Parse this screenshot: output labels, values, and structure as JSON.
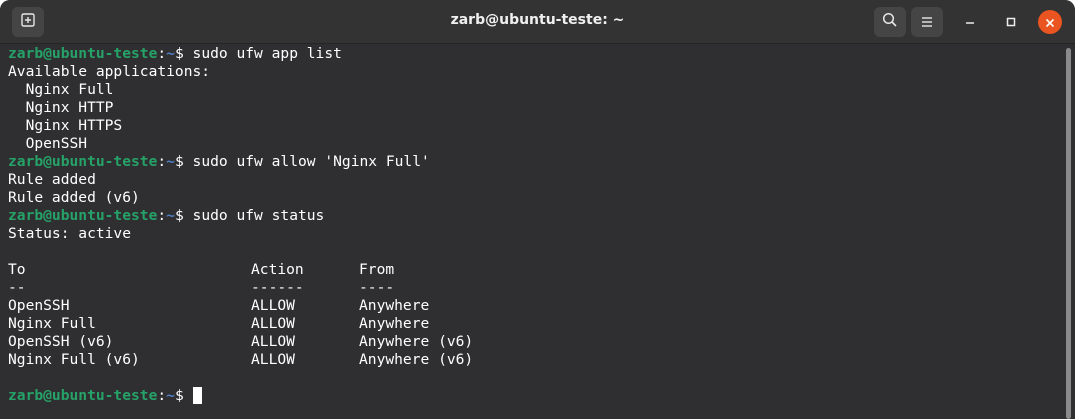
{
  "window": {
    "title": "zarb@ubuntu-teste: ~"
  },
  "titlebar": {
    "new_tab_icon": "new-tab-icon",
    "search_icon": "search-icon",
    "menu_icon": "hamburger-menu-icon",
    "minimize_icon": "minimize-icon",
    "maximize_icon": "maximize-icon",
    "close_icon": "close-icon"
  },
  "colors": {
    "prompt_user": "#26a269",
    "prompt_path": "#4e7ec2",
    "background": "#2f2f31",
    "close_button": "#e95420"
  },
  "prompt": {
    "user_host": "zarb@ubuntu-teste",
    "colon": ":",
    "path": "~",
    "symbol": "$ "
  },
  "terminal": {
    "cmd1": "sudo ufw app list",
    "out_available": "Available applications:",
    "apps": [
      "  Nginx Full",
      "  Nginx HTTP",
      "  Nginx HTTPS",
      "  OpenSSH"
    ],
    "cmd2": "sudo ufw allow 'Nginx Full'",
    "rule_added": "Rule added",
    "rule_added_v6": "Rule added (v6)",
    "cmd3": "sudo ufw status",
    "status": "Status: active",
    "table": {
      "headers": [
        "To",
        "Action",
        "From"
      ],
      "separators": [
        "--",
        "------",
        "----"
      ],
      "rows": [
        [
          "OpenSSH",
          "ALLOW",
          "Anywhere"
        ],
        [
          "Nginx Full",
          "ALLOW",
          "Anywhere"
        ],
        [
          "OpenSSH (v6)",
          "ALLOW",
          "Anywhere (v6)"
        ],
        [
          "Nginx Full (v6)",
          "ALLOW",
          "Anywhere (v6)"
        ]
      ]
    }
  }
}
